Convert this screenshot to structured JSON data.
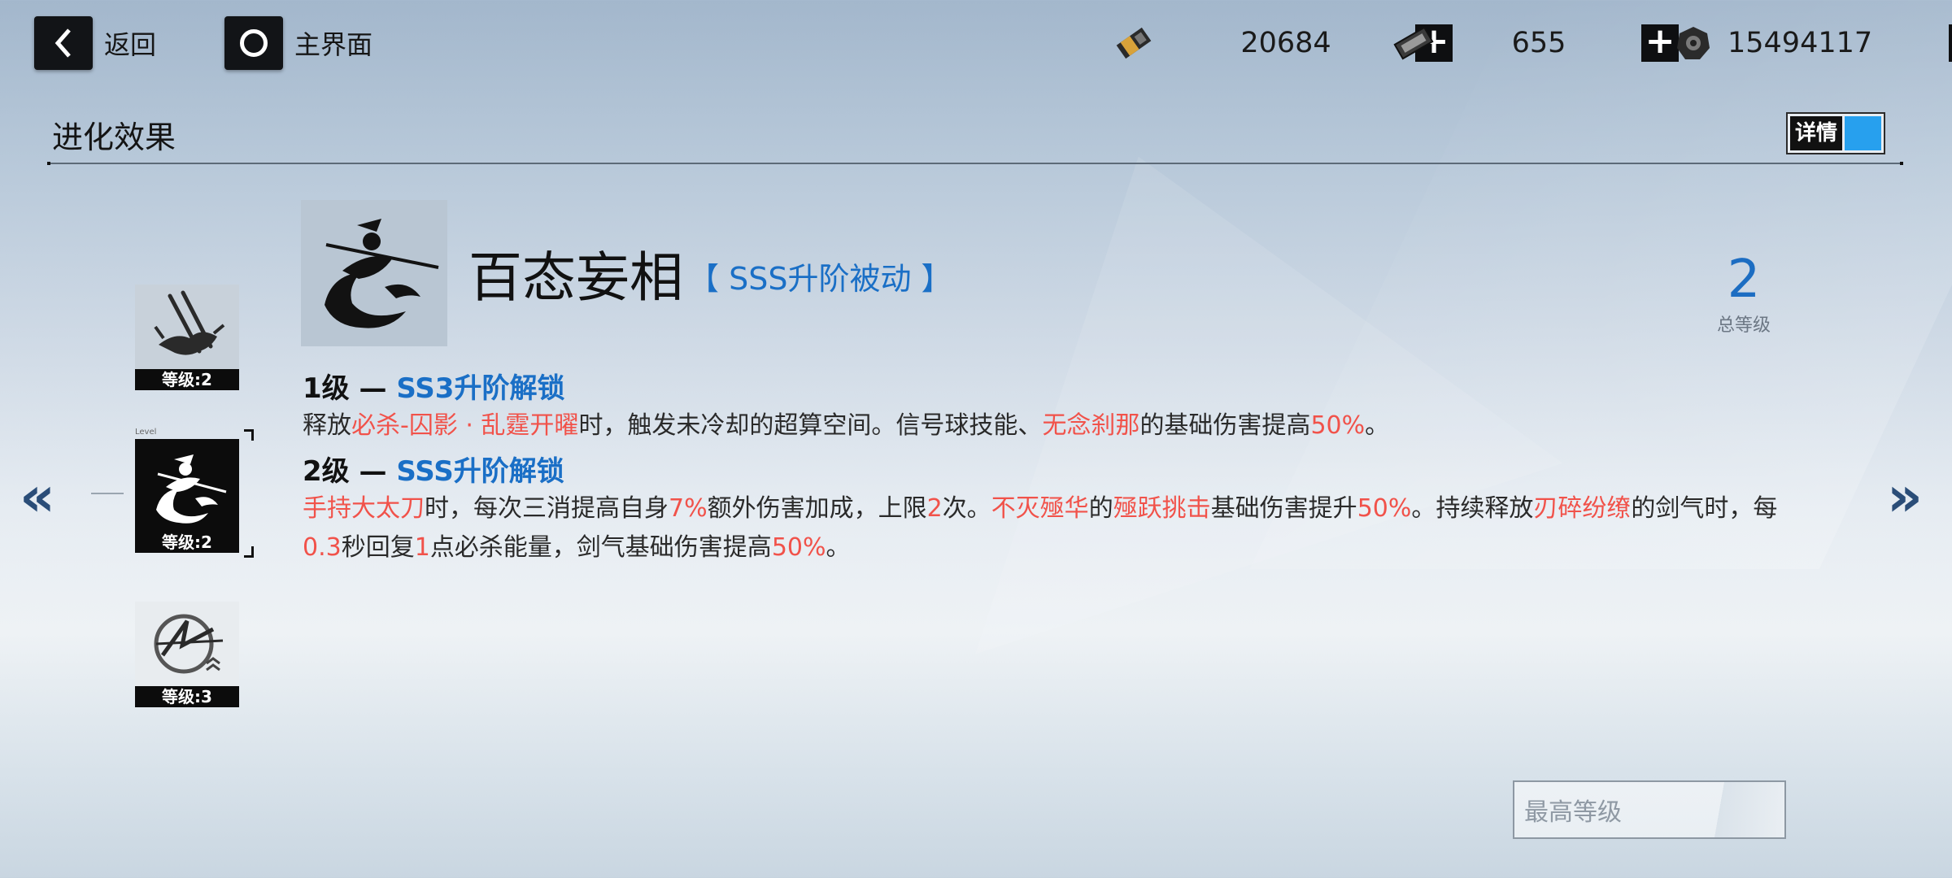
{
  "top_bar": {
    "back_label": "返回",
    "home_label": "主界面",
    "resources": [
      {
        "icon": "gold-ticket-icon",
        "value": "20684"
      },
      {
        "icon": "chip-card-icon",
        "value": "655"
      },
      {
        "icon": "coin-icon",
        "value": "15494117"
      }
    ],
    "plus_label": "+"
  },
  "section": {
    "title": "进化效果",
    "detail_toggle_label": "详情"
  },
  "skill_list": [
    {
      "icon": "spear-skill-icon",
      "level_label": "等级:2"
    },
    {
      "icon": "swordsman-skill-icon",
      "level_label": "等级:2",
      "selected": true,
      "tag": "Level"
    },
    {
      "icon": "slash-emblem-skill-icon",
      "level_label": "等级:3"
    }
  ],
  "nav": {
    "prev": "«",
    "next": "»"
  },
  "skill": {
    "name": "百态妄相",
    "tag": "【 SSS升阶被动 】",
    "total_level": "2",
    "total_level_label": "总等级",
    "levels": [
      {
        "head_prefix": "1级 — ",
        "head_sub": "SS3升阶解锁",
        "segments": [
          {
            "t": "释放",
            "h": false
          },
          {
            "t": "必杀-囚影 · 乱霆开曜",
            "h": true
          },
          {
            "t": "时，触发未冷却的超算空间。信号球技能、",
            "h": false
          },
          {
            "t": "无念刹那",
            "h": true
          },
          {
            "t": "的基础伤害提高",
            "h": false
          },
          {
            "t": "50%",
            "h": true
          },
          {
            "t": "。",
            "h": false
          }
        ]
      },
      {
        "head_prefix": "2级 — ",
        "head_sub": "SSS升阶解锁",
        "segments": [
          {
            "t": "手持大太刀",
            "h": true
          },
          {
            "t": "时，每次三消提高自身",
            "h": false
          },
          {
            "t": "7%",
            "h": true
          },
          {
            "t": "额外伤害加成，上限",
            "h": false
          },
          {
            "t": "2",
            "h": true
          },
          {
            "t": "次。",
            "h": false
          },
          {
            "t": "不灭殛华",
            "h": true
          },
          {
            "t": "的",
            "h": false
          },
          {
            "t": "殛跃挑击",
            "h": true
          },
          {
            "t": "基础伤害提升",
            "h": false
          },
          {
            "t": "50%",
            "h": true
          },
          {
            "t": "。持续释放",
            "h": false
          },
          {
            "t": "刃碎纷缭",
            "h": true
          },
          {
            "t": "的剑气时，每",
            "h": false
          },
          {
            "t": "0.3",
            "h": true
          },
          {
            "t": "秒回复",
            "h": false
          },
          {
            "t": "1",
            "h": true
          },
          {
            "t": "点必杀能量，剑气基础伤害提高",
            "h": false
          },
          {
            "t": "50%",
            "h": true
          },
          {
            "t": "。",
            "h": false
          }
        ]
      }
    ]
  },
  "max_level_button": "最高等级",
  "colors": {
    "highlight": "#f1524a",
    "accent_blue": "#1a6fc6",
    "toggle_blue": "#27a0ee"
  }
}
